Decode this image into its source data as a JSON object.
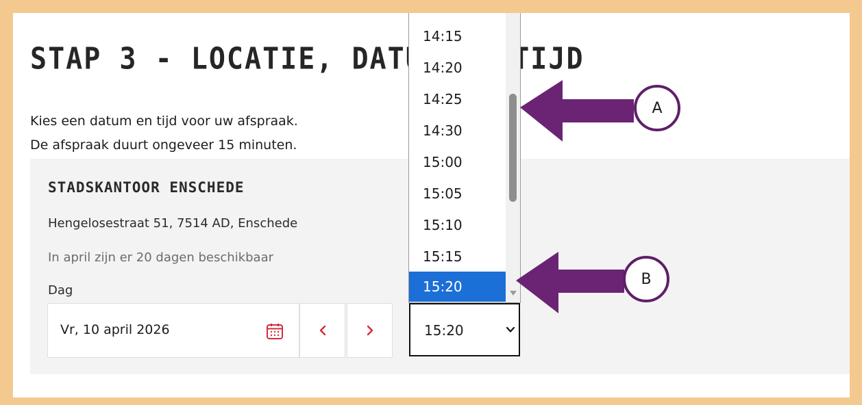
{
  "page": {
    "title": "STAP 3 - LOCATIE, DATUM EN TIJD",
    "intro_line_1": "Kies een datum en tijd voor uw afspraak.",
    "intro_line_2": "De afspraak duurt ongeveer 15 minuten."
  },
  "location": {
    "name": "STADSKANTOOR ENSCHEDE",
    "address": "Hengelosestraat 51, 7514 AD, Enschede",
    "availability": "In april zijn er 20 dagen beschikbaar",
    "day_label": "Dag",
    "date_value": "Vr, 10 april 2026",
    "calendar_icon": "calendar-icon",
    "prev_icon": "chevron-left-icon",
    "next_icon": "chevron-right-icon",
    "time_value": "15:20"
  },
  "time_dropdown": {
    "options": [
      "14:15",
      "14:20",
      "14:25",
      "14:30",
      "15:00",
      "15:05",
      "15:10",
      "15:15",
      "15:20"
    ],
    "selected": "15:20"
  },
  "annotations": {
    "callout_a": "A",
    "callout_b": "B",
    "arrow_color": "#6a2473"
  },
  "colors": {
    "frame": "#f3c98f",
    "accent_red": "#d42b3c",
    "selected_blue": "#1c6fd6",
    "card_bg": "#f3f3f3"
  }
}
